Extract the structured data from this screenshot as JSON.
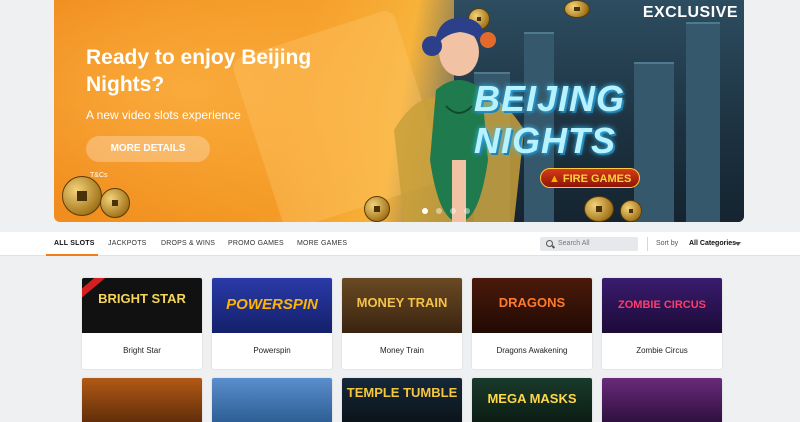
{
  "banner": {
    "headline": "Ready to enjoy Beijing Nights?",
    "subtitle": "A new video slots experience",
    "cta_label": "MORE DETAILS",
    "terms_label": "T&Cs",
    "badge": "EXCLUSIVE",
    "game_logo": "BEIJING NIGHTS",
    "provider": "FIRE GAMES",
    "slides": 4,
    "active_slide": 1
  },
  "nav": {
    "tabs": [
      {
        "label": "ALL SLOTS",
        "active": true
      },
      {
        "label": "JACKPOTS",
        "active": false
      },
      {
        "label": "DROPS & WINS",
        "active": false
      },
      {
        "label": "PROMO GAMES",
        "active": false
      },
      {
        "label": "MORE GAMES",
        "active": false
      }
    ],
    "search_placeholder": "Search All",
    "sort_label": "Sort by",
    "sort_value": "All Categories"
  },
  "games": [
    {
      "name": "Bright Star",
      "logo": "BRIGHT STAR",
      "bg": "#101010",
      "fg": "#f2d25a",
      "exclusive": true
    },
    {
      "name": "Powerspin",
      "logo": "POWERSPIN",
      "bg": "#1c2a8c",
      "fg": "#ffb400",
      "exclusive": false
    },
    {
      "name": "Money Train",
      "logo": "MONEY TRAIN",
      "bg": "#5b3a1a",
      "fg": "#f3c24a",
      "exclusive": false
    },
    {
      "name": "Dragons Awakening",
      "logo": "DRAGONS",
      "bg": "#3a1408",
      "fg": "#ff7a2a",
      "exclusive": false
    },
    {
      "name": "Zombie Circus",
      "logo": "ZOMBIE CIRCUS",
      "bg": "#2b145a",
      "fg": "#ff3d6a",
      "exclusive": false
    }
  ],
  "games_row2": [
    {
      "logo": "",
      "bg": "#8a3a10",
      "fg": "#ffd24a"
    },
    {
      "logo": "",
      "bg": "#3c6ea8",
      "fg": "#ffffff"
    },
    {
      "logo": "TEMPLE TUMBLE",
      "bg": "#0e1c2a",
      "fg": "#f5c73a"
    },
    {
      "logo": "MEGA MASKS",
      "bg": "#102a20",
      "fg": "#ffd84a"
    },
    {
      "logo": "",
      "bg": "#4a1e5a",
      "fg": "#ffb8e0"
    }
  ]
}
